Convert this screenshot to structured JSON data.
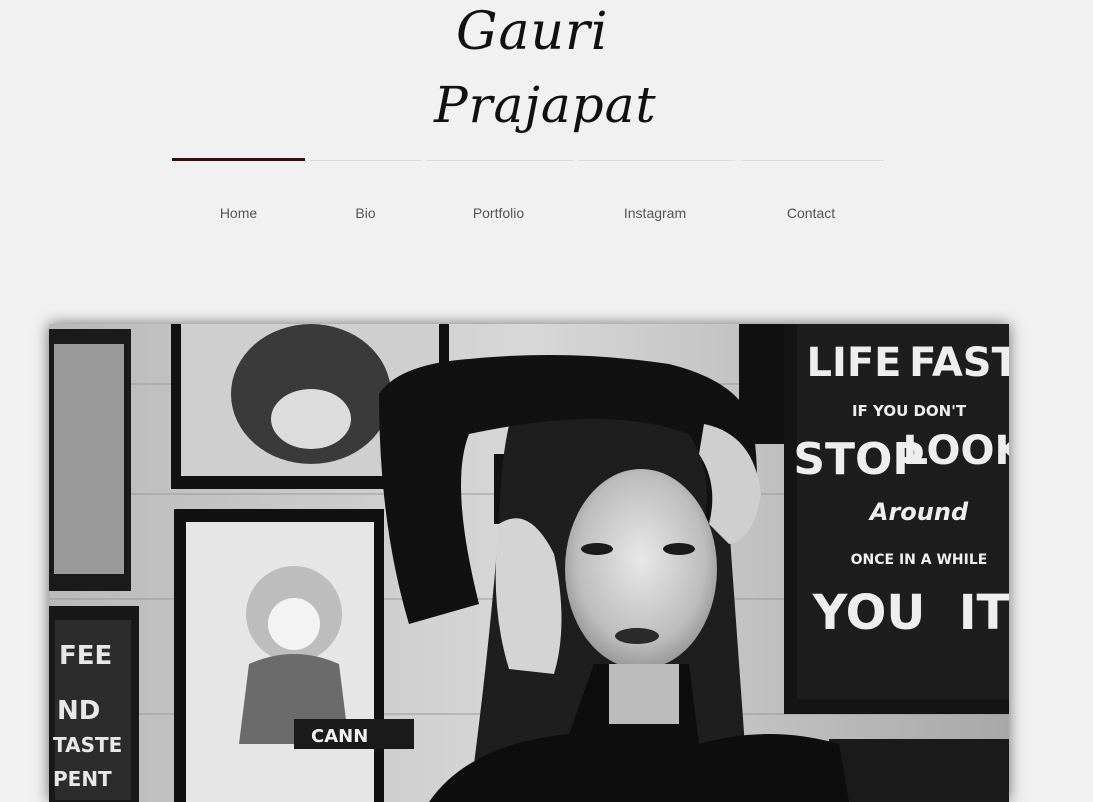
{
  "logo": {
    "line1": "Gauri",
    "line2": "Prajapat"
  },
  "nav": {
    "active_index": 0,
    "items": [
      {
        "label": "Home"
      },
      {
        "label": "Bio"
      },
      {
        "label": "Portfolio"
      },
      {
        "label": "Instagram"
      },
      {
        "label": "Contact"
      }
    ]
  },
  "hero": {
    "poster_text": {
      "l1": "LIFE",
      "l2": "FAST",
      "l3": "IF YOU DON'T",
      "l4": "STOP",
      "l5": "LOOK",
      "l6": "Around",
      "l7": "ONCE IN A WHILE",
      "l8": "YOU",
      "l9": "IT"
    },
    "left_poster_text": {
      "l1": "FEE",
      "l2": "ND",
      "l3": "TASTE",
      "l4": "PENT"
    },
    "bottom_label": "CANN"
  },
  "colors": {
    "background": "#f1f1f1",
    "active_tab": "#3a0d0d",
    "nav_text": "#555555"
  }
}
